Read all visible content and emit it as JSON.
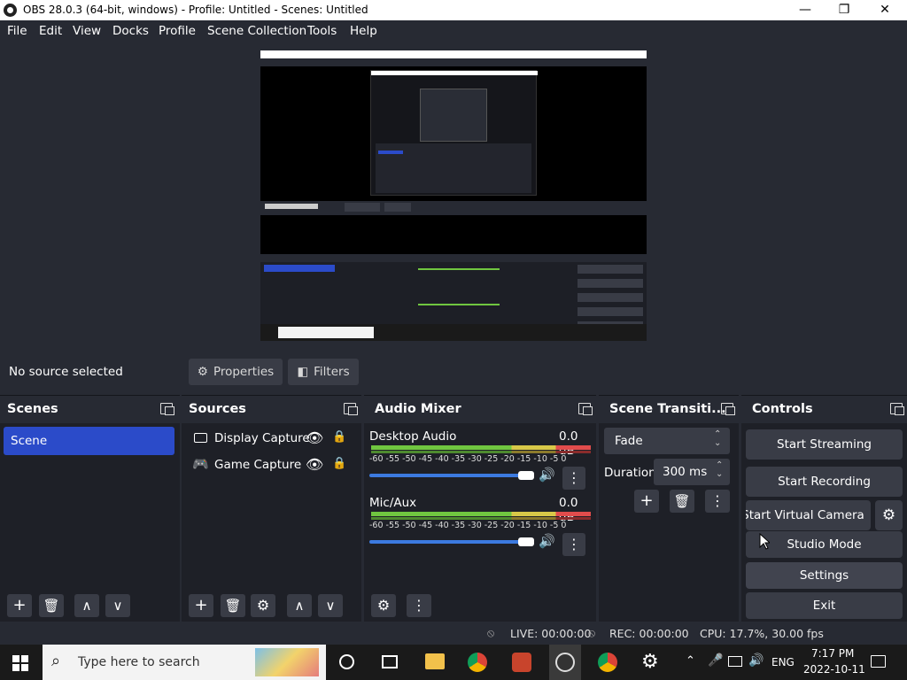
{
  "window": {
    "title": "OBS 28.0.3 (64-bit, windows) - Profile: Untitled - Scenes: Untitled",
    "minimize_glyph": "—",
    "maximize_glyph": "❐",
    "close_glyph": "✕"
  },
  "menu": [
    "File",
    "Edit",
    "View",
    "Docks",
    "Profile",
    "Scene Collection",
    "Tools",
    "Help"
  ],
  "context_bar": {
    "status": "No source selected",
    "properties": "Properties",
    "filters": "Filters"
  },
  "scenes": {
    "title": "Scenes",
    "items": [
      "Scene"
    ]
  },
  "sources": {
    "title": "Sources",
    "items": [
      "Display Capture",
      "Game Capture"
    ]
  },
  "mixer": {
    "title": "Audio Mixer",
    "channels": [
      {
        "name": "Desktop Audio",
        "db": "0.0 dB",
        "volume": 1.0
      },
      {
        "name": "Mic/Aux",
        "db": "0.0 dB",
        "volume": 1.0
      }
    ],
    "ticks": "-60 -55 -50 -45 -40 -35 -30 -25 -20 -15 -10  -5   0"
  },
  "transitions": {
    "title": "Scene Transiti...",
    "selected": "Fade",
    "duration_label": "Duration",
    "duration_value": "300 ms"
  },
  "controls": {
    "title": "Controls",
    "start_streaming": "Start Streaming",
    "start_recording": "Start Recording",
    "start_virtual_camera": "Start Virtual Camera",
    "studio_mode": "Studio Mode",
    "settings": "Settings",
    "exit": "Exit"
  },
  "status": {
    "live": "LIVE: 00:00:00",
    "rec": "REC: 00:00:00",
    "cpu": "CPU: 17.7%, 30.00 fps"
  },
  "taskbar": {
    "search_placeholder": "Type here to search",
    "language": "ENG",
    "time": "7:17 PM",
    "date": "2022-10-11"
  },
  "colors": {
    "accent": "#2b4bc9",
    "panel": "#1e2027",
    "header": "#272a33",
    "button": "#393c46"
  }
}
